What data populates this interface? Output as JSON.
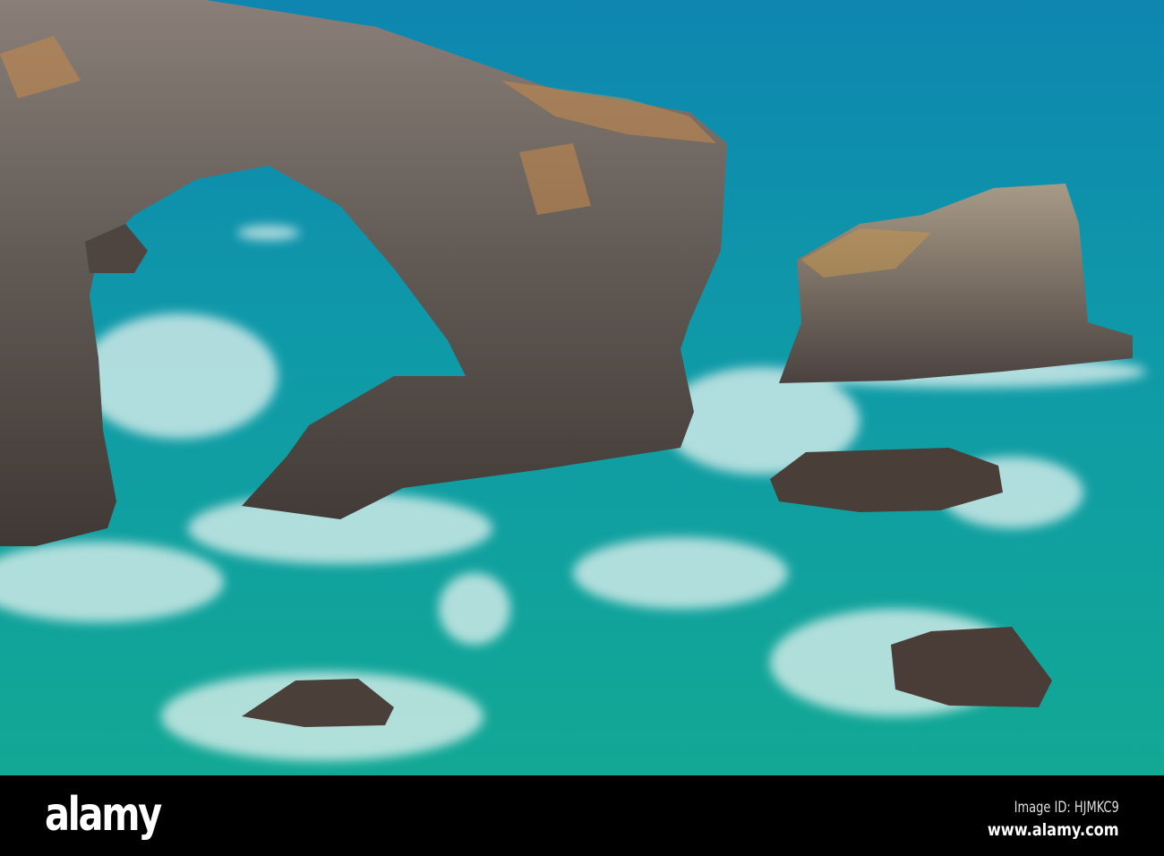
{
  "photo": {
    "subject": "sea arch and rock stack in turquoise sea",
    "colors": {
      "sea_deep": "#0a8aa8",
      "sea_turquoise": "#14a89a",
      "rock": "#5e5550",
      "rock_light": "#9a8e86",
      "lichen": "#c98a4a",
      "foam": "#e8f4f2"
    }
  },
  "watermark": {
    "logo": "alamy",
    "image_id": "Image ID: HJMKC9",
    "site": "www.alamy.com"
  }
}
